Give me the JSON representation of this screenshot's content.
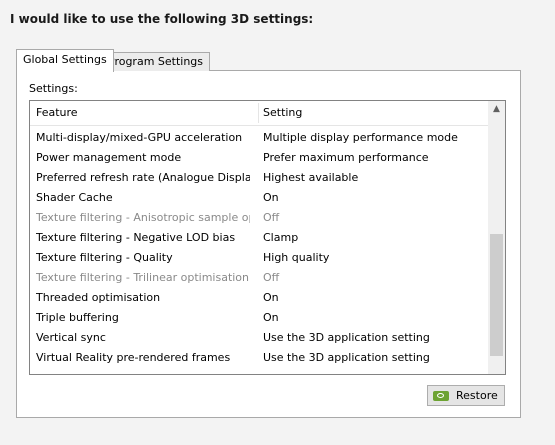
{
  "heading": "I would like to use the following 3D settings:",
  "tabs": [
    {
      "label": "Global Settings"
    },
    {
      "label": "Program Settings"
    }
  ],
  "settings_label": "Settings:",
  "columns": {
    "feature": "Feature",
    "setting": "Setting"
  },
  "rows": [
    {
      "feature": "Multi-display/mixed-GPU acceleration",
      "setting": "Multiple display performance mode",
      "enabled": true
    },
    {
      "feature": "Power management mode",
      "setting": "Prefer maximum performance",
      "enabled": true
    },
    {
      "feature": "Preferred refresh rate (Analogue Display)",
      "setting": "Highest available",
      "enabled": true
    },
    {
      "feature": "Shader Cache",
      "setting": "On",
      "enabled": true
    },
    {
      "feature": "Texture filtering - Anisotropic sample opti…",
      "setting": "Off",
      "enabled": false
    },
    {
      "feature": "Texture filtering - Negative LOD bias",
      "setting": "Clamp",
      "enabled": true
    },
    {
      "feature": "Texture filtering - Quality",
      "setting": "High quality",
      "enabled": true
    },
    {
      "feature": "Texture filtering - Trilinear optimisation",
      "setting": "Off",
      "enabled": false
    },
    {
      "feature": "Threaded optimisation",
      "setting": "On",
      "enabled": true
    },
    {
      "feature": "Triple buffering",
      "setting": "On",
      "enabled": true
    },
    {
      "feature": "Vertical sync",
      "setting": "Use the 3D application setting",
      "enabled": true
    },
    {
      "feature": "Virtual Reality pre-rendered frames",
      "setting": "Use the 3D application setting",
      "enabled": true
    }
  ],
  "restore_label": "Restore",
  "icons": {
    "scroll_up": "chevron-up-icon",
    "restore": "nvidia-logo-icon"
  },
  "colors": {
    "disabled_text": "#8a8a8a",
    "nvidia_green": "#6da332"
  }
}
